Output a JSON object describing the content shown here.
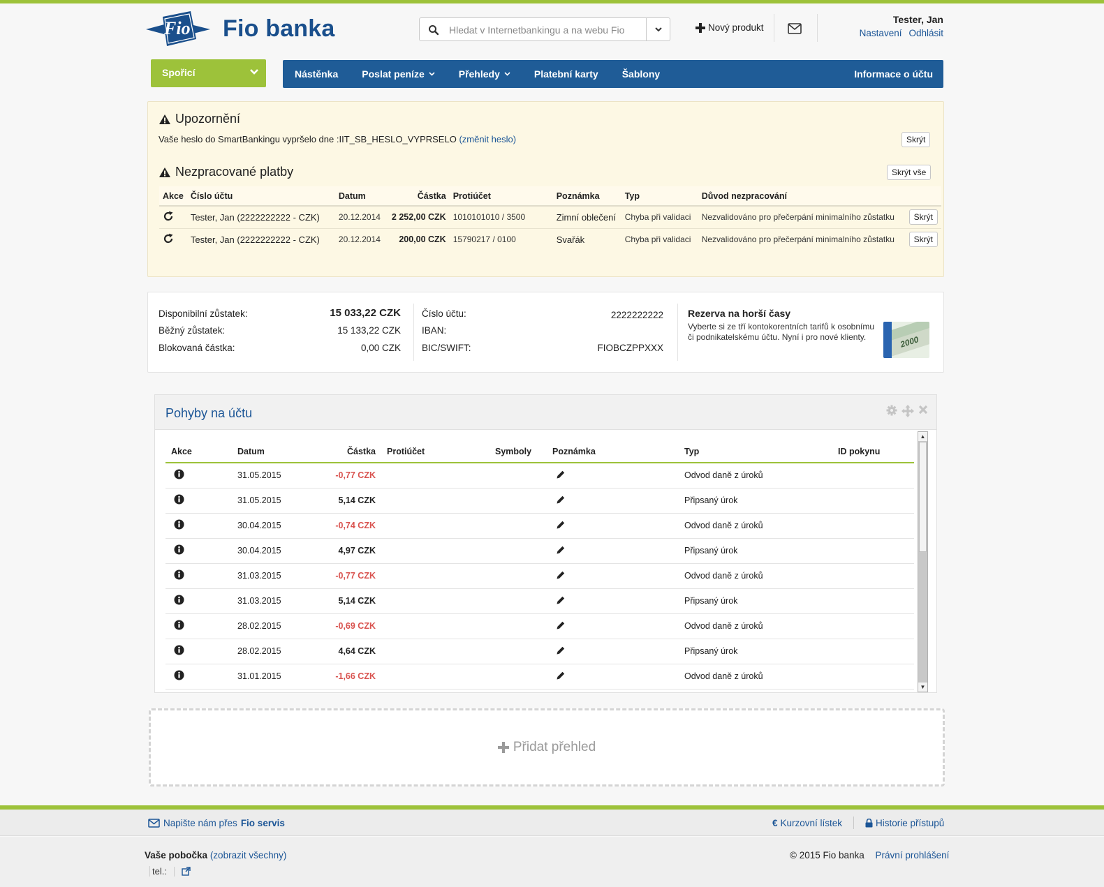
{
  "header": {
    "logo_mark": "Fio",
    "logo_text": "Fio banka",
    "search_placeholder": "Hledat v Internetbankingu a na webu Fio",
    "new_product": "Nový produkt",
    "user_name": "Tester, Jan",
    "settings": "Nastavení",
    "logout": "Odhlásit"
  },
  "nav": {
    "account_select": "Spořicí",
    "items": [
      "Nástěnka",
      "Poslat peníze",
      "Přehledy",
      "Platební karty",
      "Šablony"
    ],
    "account_info": "Informace o účtu"
  },
  "warning": {
    "title": "Upozornění",
    "message": "Vaše heslo do SmartBankingu vypršelo dne :IIT_SB_HESLO_VYPRSELO",
    "change_link": "(změnit heslo)",
    "hide": "Skrýt",
    "unprocessed_title": "Nezpracované platby",
    "hide_all": "Skrýt vše",
    "columns": [
      "Akce",
      "Číslo účtu",
      "Datum",
      "Částka",
      "Protiúčet",
      "Poznámka",
      "Typ",
      "Důvod nezpracování"
    ],
    "rows": [
      {
        "account": "Tester, Jan (2222222222 - CZK)",
        "date": "20.12.2014",
        "amount": "2 252,00 CZK",
        "counter": "1010101010 / 3500",
        "note": "Zimní oblečení",
        "type": "Chyba při validaci",
        "reason": "Nezvalidováno pro přečerpání minimalního zůstatku",
        "hide": "Skrýt"
      },
      {
        "account": "Tester, Jan (2222222222 - CZK)",
        "date": "20.12.2014",
        "amount": "200,00 CZK",
        "counter": "15790217 / 0100",
        "note": "Svařák",
        "type": "Chyba při validaci",
        "reason": "Nezvalidováno pro přečerpání minimalního zůstatku",
        "hide": "Skrýt"
      }
    ]
  },
  "balance": {
    "available_label": "Disponibilní zůstatek:",
    "available_value": "15 033,22 CZK",
    "current_label": "Běžný zůstatek:",
    "current_value": "15 133,22 CZK",
    "blocked_label": "Blokovaná částka:",
    "blocked_value": "0,00 CZK",
    "account_label": "Číslo účtu:",
    "account_value": "2222222222",
    "iban_label": "IBAN:",
    "iban_value": "",
    "bic_label": "BIC/SWIFT:",
    "bic_value": "FIOBCZPPXXX",
    "promo_title": "Rezerva na horší časy",
    "promo_text": "Vyberte si ze tří kontokorentních tarifů k osobnímu či podnikatelskému účtu. Nyní i pro nové klienty.",
    "promo_image_text": "2000"
  },
  "movements": {
    "title": "Pohyby na účtu",
    "columns": [
      "Akce",
      "Datum",
      "Částka",
      "Protiúčet",
      "Symboly",
      "Poznámka",
      "Typ",
      "ID pokynu"
    ],
    "rows": [
      {
        "date": "31.05.2015",
        "amount": "-0,77 CZK",
        "negative": true,
        "type": "Odvod daně z úroků"
      },
      {
        "date": "31.05.2015",
        "amount": "5,14 CZK",
        "negative": false,
        "type": "Připsaný úrok"
      },
      {
        "date": "30.04.2015",
        "amount": "-0,74 CZK",
        "negative": true,
        "type": "Odvod daně z úroků"
      },
      {
        "date": "30.04.2015",
        "amount": "4,97 CZK",
        "negative": false,
        "type": "Připsaný úrok"
      },
      {
        "date": "31.03.2015",
        "amount": "-0,77 CZK",
        "negative": true,
        "type": "Odvod daně z úroků"
      },
      {
        "date": "31.03.2015",
        "amount": "5,14 CZK",
        "negative": false,
        "type": "Připsaný úrok"
      },
      {
        "date": "28.02.2015",
        "amount": "-0,69 CZK",
        "negative": true,
        "type": "Odvod daně z úroků"
      },
      {
        "date": "28.02.2015",
        "amount": "4,64 CZK",
        "negative": false,
        "type": "Připsaný úrok"
      },
      {
        "date": "31.01.2015",
        "amount": "-1,66 CZK",
        "negative": true,
        "type": "Odvod daně z úroků"
      }
    ]
  },
  "add_overview": "Přidat přehled",
  "footer": {
    "write_us": "Napište nám přes",
    "fio_servis": "Fio servis",
    "exchange": "Kurzovní lístek",
    "history": "Historie přístupů",
    "branch_label": "Vaše pobočka",
    "show_all": "(zobrazit všechny)",
    "tel": "tel.:",
    "copyright": "© 2015 Fio banka",
    "legal": "Právní prohlášení"
  },
  "colors": {
    "green": "#9dc23a",
    "blue": "#1f5c97",
    "link": "#1b5596",
    "negative": "#d9534f",
    "warning_bg": "#fdf8e4"
  }
}
